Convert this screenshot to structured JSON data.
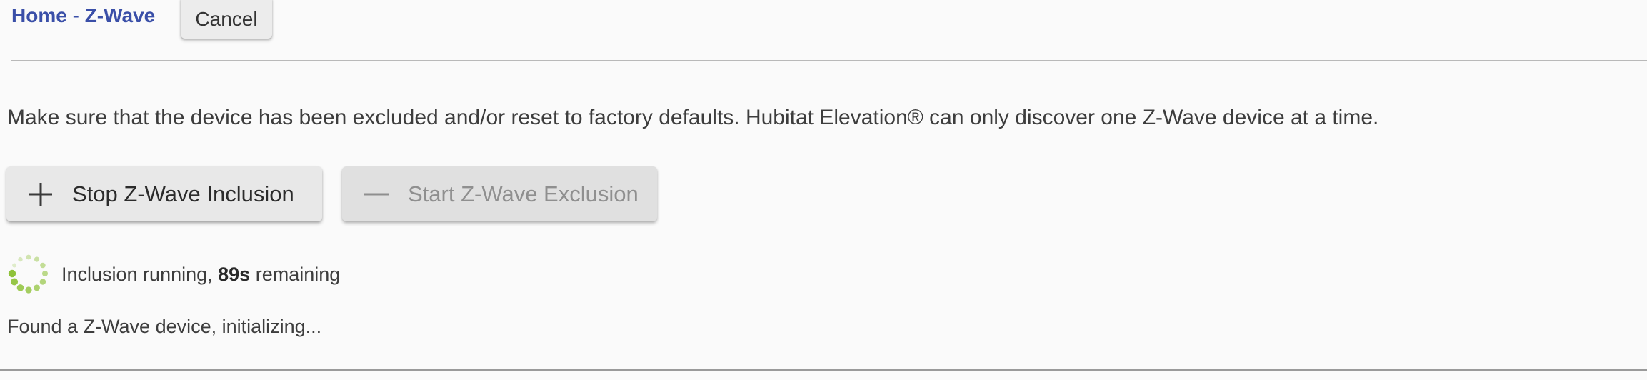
{
  "breadcrumb": {
    "home": "Home",
    "separator": " - ",
    "current": "Z-Wave"
  },
  "header": {
    "cancel_label": "Cancel"
  },
  "instruction": "Make sure that the device has been excluded and/or reset to factory defaults. Hubitat Elevation® can only discover one Z-Wave device at a time.",
  "actions": {
    "inclusion": {
      "icon": "plus-icon",
      "label": "Stop Z-Wave Inclusion"
    },
    "exclusion": {
      "icon": "minus-icon",
      "label": "Start Z-Wave Exclusion"
    }
  },
  "status": {
    "spinner_icon": "loading-spinner-icon",
    "prefix": "Inclusion running, ",
    "seconds": "89s",
    "suffix": " remaining",
    "found": "Found a Z-Wave device, initializing..."
  },
  "colors": {
    "link": "#3a4fa8",
    "spinner": "#8fc23a",
    "background": "#fafafa"
  }
}
